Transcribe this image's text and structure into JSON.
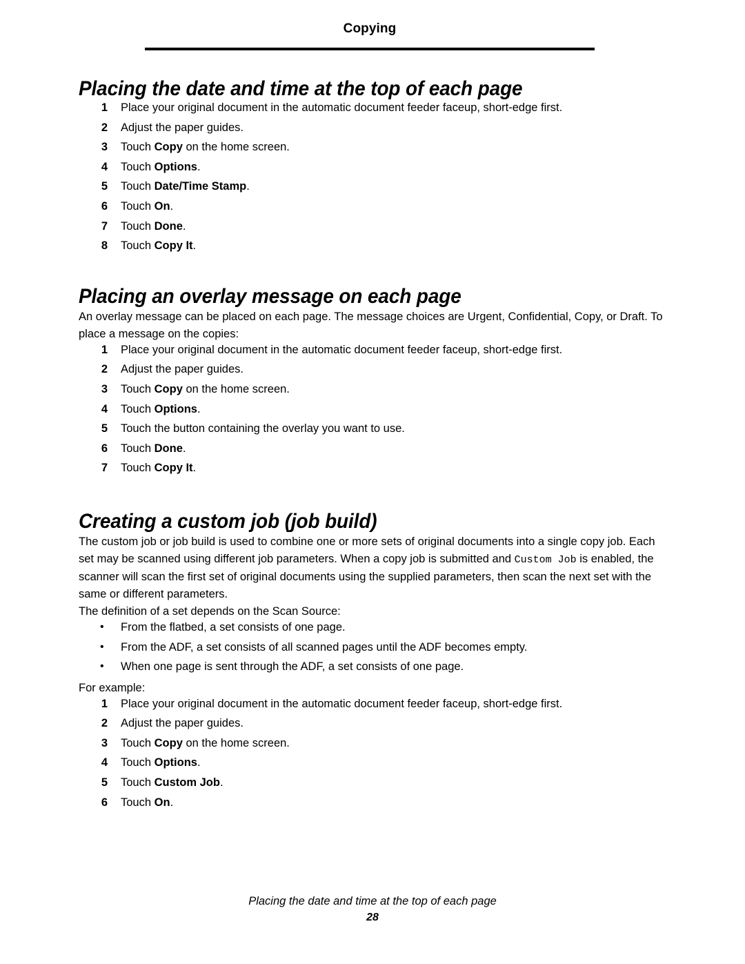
{
  "header": {
    "running_title": "Copying"
  },
  "footer": {
    "running_title": "Placing the date and time at the top of each page",
    "page_number": "28"
  },
  "sections": [
    {
      "heading": "Placing the date and time at the top of each page",
      "steps": [
        {
          "num": "1",
          "pre": "Place your original document in the automatic document feeder faceup, short-edge first.",
          "bold": "",
          "post": ""
        },
        {
          "num": "2",
          "pre": "Adjust the paper guides.",
          "bold": "",
          "post": ""
        },
        {
          "num": "3",
          "pre": "Touch ",
          "bold": "Copy",
          "post": " on the home screen."
        },
        {
          "num": "4",
          "pre": "Touch ",
          "bold": "Options",
          "post": "."
        },
        {
          "num": "5",
          "pre": "Touch ",
          "bold": "Date/Time Stamp",
          "post": "."
        },
        {
          "num": "6",
          "pre": "Touch ",
          "bold": "On",
          "post": "."
        },
        {
          "num": "7",
          "pre": "Touch ",
          "bold": "Done",
          "post": "."
        },
        {
          "num": "8",
          "pre": "Touch ",
          "bold": "Copy It",
          "post": "."
        }
      ]
    },
    {
      "heading": "Placing an overlay message on each page",
      "intro": "An overlay message can be placed on each page. The message choices are Urgent, Confidential, Copy, or Draft. To place a message on the copies:",
      "steps": [
        {
          "num": "1",
          "pre": "Place your original document in the automatic document feeder faceup, short-edge first.",
          "bold": "",
          "post": ""
        },
        {
          "num": "2",
          "pre": "Adjust the paper guides.",
          "bold": "",
          "post": ""
        },
        {
          "num": "3",
          "pre": "Touch ",
          "bold": "Copy",
          "post": " on the home screen."
        },
        {
          "num": "4",
          "pre": "Touch ",
          "bold": "Options",
          "post": "."
        },
        {
          "num": "5",
          "pre": "Touch the button containing the overlay you want to use.",
          "bold": "",
          "post": ""
        },
        {
          "num": "6",
          "pre": "Touch ",
          "bold": "Done",
          "post": "."
        },
        {
          "num": "7",
          "pre": "Touch ",
          "bold": "Copy It",
          "post": "."
        }
      ]
    },
    {
      "heading": "Creating a custom job (job build)",
      "intro_part1": "The custom job or job build is used to combine one or more sets of original documents into a single copy job. Each set may be scanned using different job parameters. When a copy job is submitted and ",
      "intro_mono": "Custom Job",
      "intro_part2": " is enabled, the scanner will scan the first set of original documents using the supplied parameters, then scan the next set with the same or different parameters.",
      "scan_source_lead": "The definition of a set depends on the Scan Source:",
      "bullets": [
        "From the flatbed, a set consists of one page.",
        "From the ADF, a set consists of all scanned pages until the ADF becomes empty.",
        "When one page is sent through the ADF, a set consists of one page."
      ],
      "example_lead": "For example:",
      "steps": [
        {
          "num": "1",
          "pre": "Place your original document in the automatic document feeder faceup, short-edge first.",
          "bold": "",
          "post": ""
        },
        {
          "num": "2",
          "pre": "Adjust the paper guides.",
          "bold": "",
          "post": ""
        },
        {
          "num": "3",
          "pre": "Touch ",
          "bold": "Copy",
          "post": " on the home screen."
        },
        {
          "num": "4",
          "pre": "Touch ",
          "bold": "Options",
          "post": "."
        },
        {
          "num": "5",
          "pre": "Touch ",
          "bold": "Custom Job",
          "post": "."
        },
        {
          "num": "6",
          "pre": "Touch ",
          "bold": "On",
          "post": "."
        }
      ]
    }
  ]
}
